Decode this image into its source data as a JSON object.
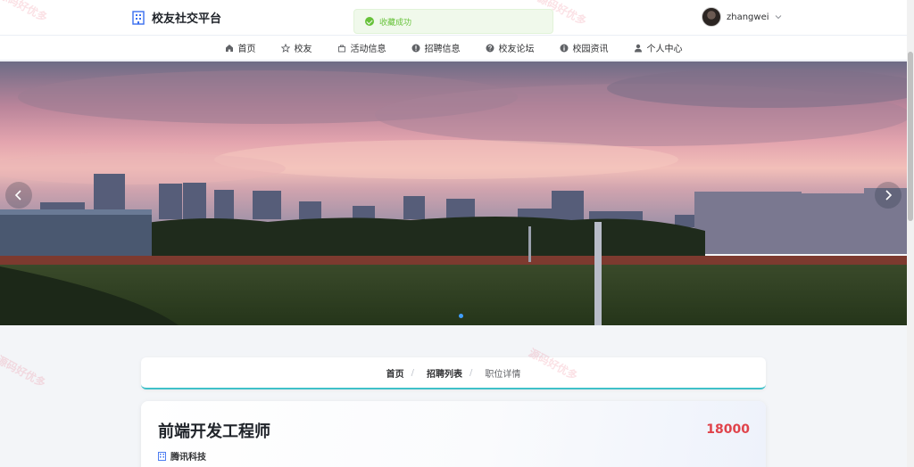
{
  "header": {
    "brand_title": "校友社交平台",
    "username": "zhangwei"
  },
  "toast": {
    "message": "收藏成功",
    "status": "success",
    "color": "#67c23a"
  },
  "nav": {
    "items": [
      {
        "label": "首页",
        "icon": "home-icon"
      },
      {
        "label": "校友",
        "icon": "star-icon"
      },
      {
        "label": "活动信息",
        "icon": "bag-icon"
      },
      {
        "label": "招聘信息",
        "icon": "info-circle-icon"
      },
      {
        "label": "校友论坛",
        "icon": "question-circle-icon"
      },
      {
        "label": "校园资讯",
        "icon": "info-circle-icon"
      },
      {
        "label": "个人中心",
        "icon": "user-icon"
      }
    ]
  },
  "carousel": {
    "image": "campus-sunset-photo",
    "active_slide": 1,
    "indicator_color": "#409eff"
  },
  "breadcrumb": {
    "items": [
      "首页",
      "招聘列表"
    ],
    "separator": "/",
    "current": "职位详情"
  },
  "job": {
    "title": "前端开发工程师",
    "salary": "18000",
    "company": "腾讯科技",
    "salary_color": "#e0434b"
  },
  "watermark": {
    "text": "源码好优多"
  }
}
